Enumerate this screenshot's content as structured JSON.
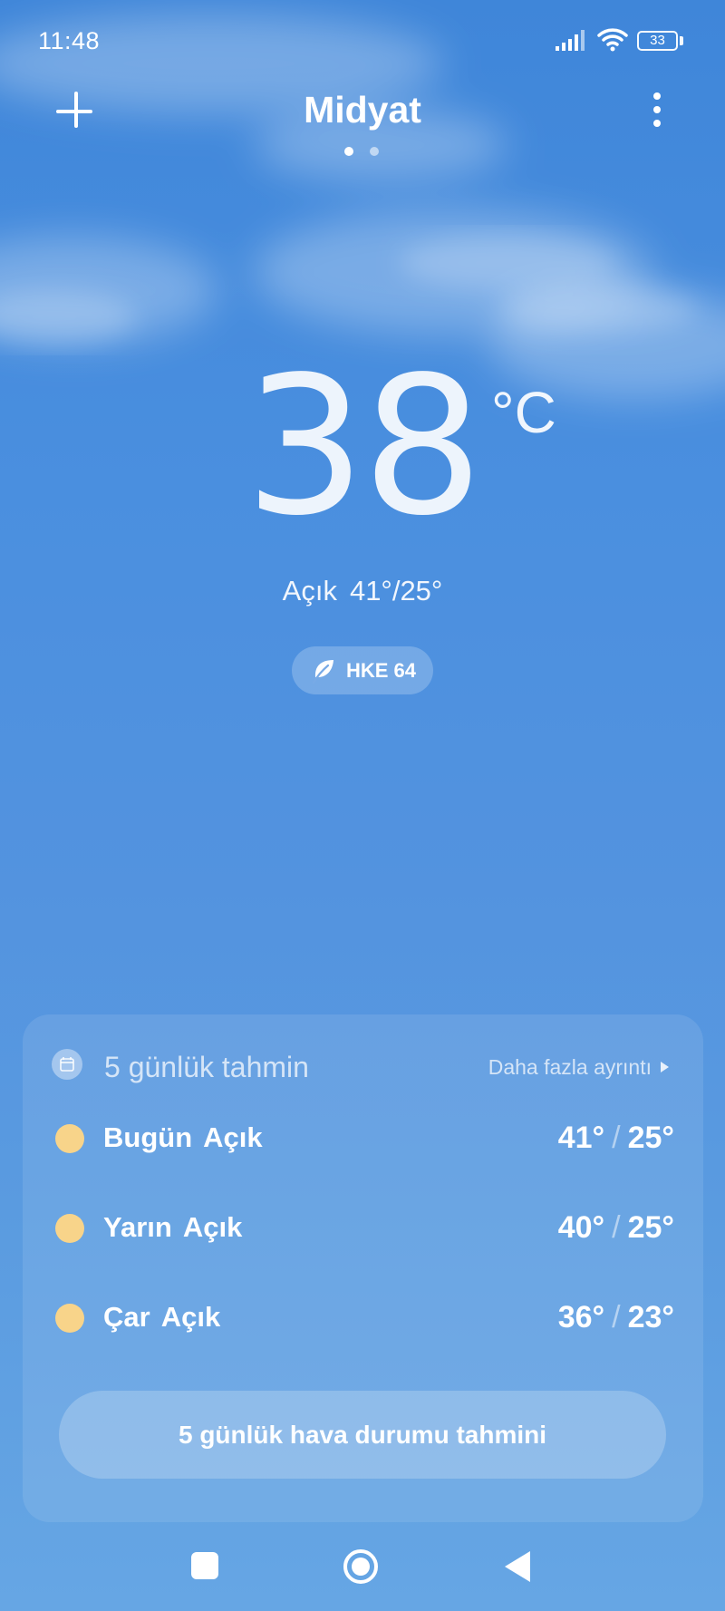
{
  "status_bar": {
    "time": "11:48",
    "battery": "33"
  },
  "header": {
    "city": "Midyat",
    "page_count": 2,
    "active_page": 1
  },
  "current": {
    "temperature": "38",
    "unit": "°C",
    "condition": "Açık",
    "high_low": "41°/25°",
    "aqi_label": "HKE 64"
  },
  "forecast": {
    "title": "5 günlük tahmin",
    "more_details": "Daha fazla ayrıntı",
    "days": [
      {
        "day": "Bugün",
        "condition": "Açık",
        "high": "41°",
        "low": "25°"
      },
      {
        "day": "Yarın",
        "condition": "Açık",
        "high": "40°",
        "low": "25°"
      },
      {
        "day": "Çar",
        "condition": "Açık",
        "high": "36°",
        "low": "23°"
      }
    ],
    "button_label": "5 günlük hava durumu tahmini"
  },
  "icons": {
    "add": "plus-icon",
    "more": "vertical-dots-icon",
    "aqi": "leaf-icon",
    "forecast_header": "calendar-icon",
    "day_condition": "sun-icon"
  },
  "colors": {
    "sky_top": "#3f86d9",
    "sky_bottom": "#66a6e4",
    "sun": "#f8d48a"
  }
}
